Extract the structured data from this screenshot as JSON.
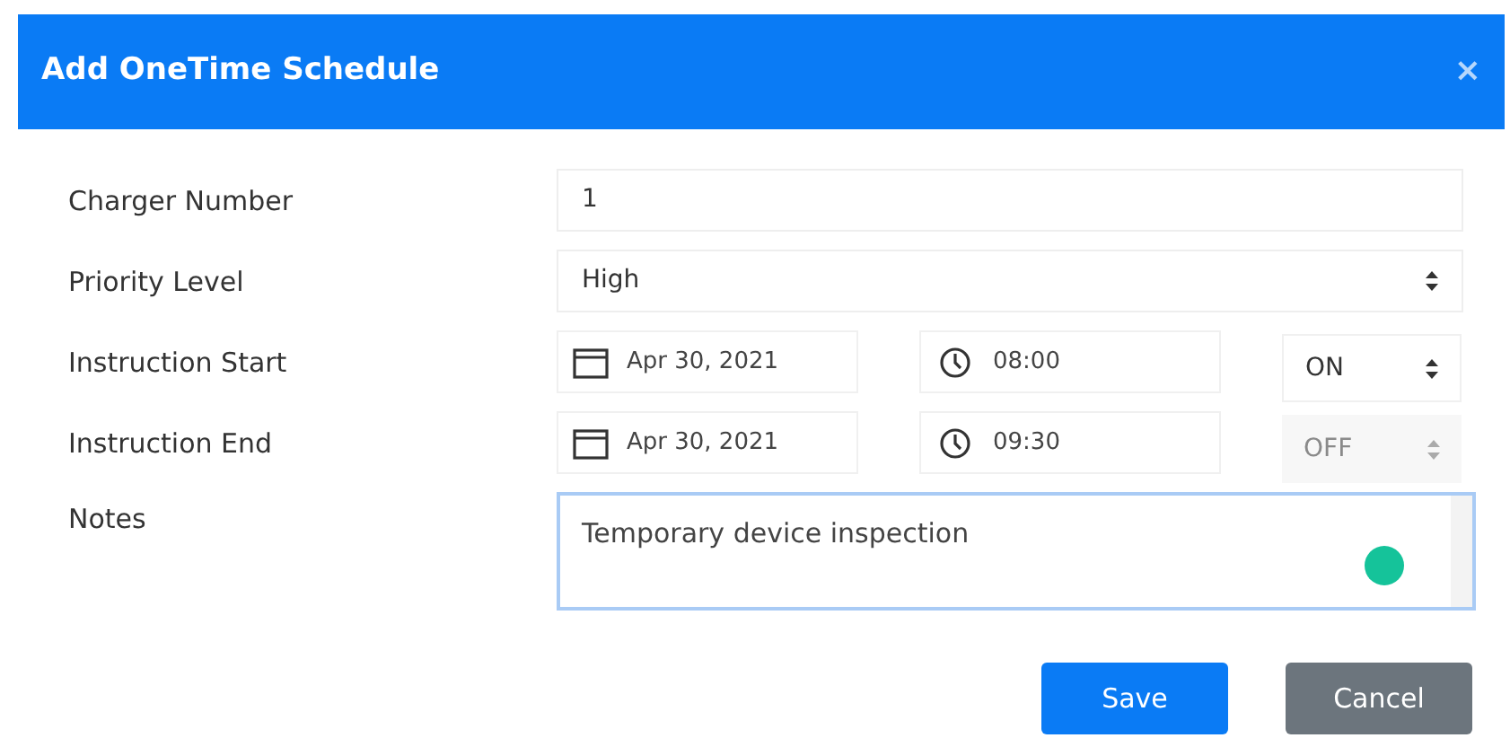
{
  "dialog": {
    "title": "Add OneTime Schedule",
    "close": "×"
  },
  "fields": [
    {
      "kind": "text",
      "label": "Charger Number",
      "value": "1"
    },
    {
      "kind": "select",
      "label": "Priority Level",
      "value": "High"
    },
    {
      "kind": "datetime",
      "label": "Instruction Start",
      "date": "Apr 30, 2021",
      "time": "08:00",
      "toggle": "ON",
      "disabled": false
    },
    {
      "kind": "datetime",
      "label": "Instruction End",
      "date": "Apr 30, 2021",
      "time": "09:30",
      "toggle": "OFF",
      "disabled": true
    },
    {
      "kind": "textarea",
      "label": "Notes",
      "value": "Temporary device inspection"
    }
  ],
  "buttons": [
    {
      "label": "Save",
      "kind": "primary"
    },
    {
      "label": "Cancel",
      "kind": "secondary"
    }
  ]
}
